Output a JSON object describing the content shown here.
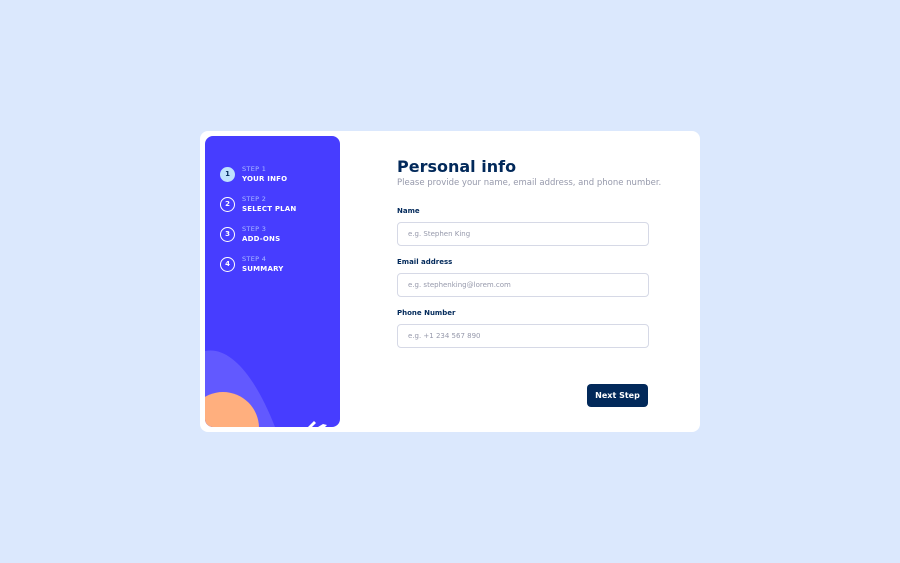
{
  "colors": {
    "page_bg": "#dbe8fd",
    "sidebar_bg": "#473dff",
    "marine_blue": "#02295a",
    "active_step_bg": "#bfe2fd",
    "shape_purple": "#6259ff",
    "shape_orange": "#ffaf7e",
    "cool_gray": "#9699ab",
    "border": "#d6d9e6"
  },
  "sidebar": {
    "steps": [
      {
        "number": "1",
        "caption": "STEP 1",
        "label": "YOUR INFO",
        "active": true
      },
      {
        "number": "2",
        "caption": "STEP 2",
        "label": "SELECT PLAN",
        "active": false
      },
      {
        "number": "3",
        "caption": "STEP 3",
        "label": "ADD-ONS",
        "active": false
      },
      {
        "number": "4",
        "caption": "STEP 4",
        "label": "SUMMARY",
        "active": false
      }
    ]
  },
  "form": {
    "title": "Personal info",
    "subtitle": "Please provide your name, email address, and phone number.",
    "fields": [
      {
        "label": "Name",
        "placeholder": "e.g. Stephen King",
        "value": ""
      },
      {
        "label": "Email address",
        "placeholder": "e.g. stephenking@lorem.com",
        "value": ""
      },
      {
        "label": "Phone Number",
        "placeholder": "e.g. +1 234 567 890",
        "value": ""
      }
    ],
    "next_label": "Next Step"
  }
}
